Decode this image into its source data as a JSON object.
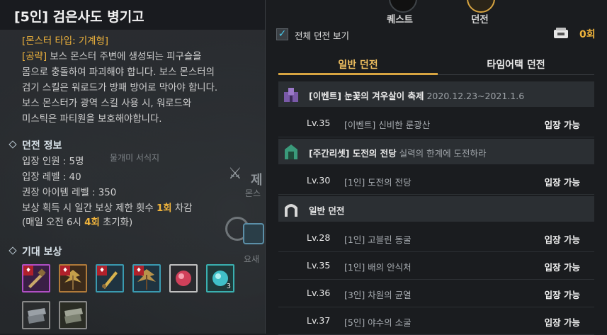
{
  "left": {
    "title": "[5인] 검은사도 병기고",
    "monster_type": "[몬스터 타입: 기계형]",
    "strategy_tag": "[공략]",
    "strategy_lines": [
      " 보스 몬스터 주변에 생성되는 피구슬을",
      "몸으로 충돌하여 파괴해야 합니다. 보스 몬스터의",
      "검기 스킬은 워로드가 방패 방어로 막아야 합니다.",
      "보스 몬스터가 광역 스킬 사용 시, 워로드와",
      "미스틱은 파티원을 보호해야합니다."
    ],
    "info_header": "던전 정보",
    "info_lines": [
      "입장 인원 : 5명",
      "입장 레벨 : 40",
      "권장 아이템 레벨 : 350"
    ],
    "reward_limit_prefix": "보상 획득 시 일간 보상 제한 횟수 ",
    "reward_limit_value": "1회",
    "reward_limit_suffix": " 차감",
    "reset_prefix": "(매일 오전 6시 ",
    "reset_value": "4회",
    "reset_suffix": " 초기화)",
    "rewards_header": "기대 보상",
    "map_labels": {
      "area": "물개미 서식지",
      "big": "제",
      "small1": "몬스",
      "small2": "요새"
    },
    "rewards": [
      {
        "icon": "greatsword-icon",
        "badge": "♦",
        "count": "",
        "border": "#b04fc4"
      },
      {
        "icon": "winged-staff-icon",
        "badge": "♦",
        "count": "",
        "border": "#b07a3a"
      },
      {
        "icon": "golden-sword-icon",
        "badge": "♦",
        "count": "",
        "border": "#3a9ab0"
      },
      {
        "icon": "winged-staff-gold-icon",
        "badge": "♦",
        "count": "",
        "border": "#3a9ab0"
      },
      {
        "icon": "red-gem-icon",
        "badge": "",
        "count": "",
        "border": "#c0c0c0"
      },
      {
        "icon": "blue-gem-icon",
        "badge": "",
        "count": "3",
        "border": "#3ab0b0"
      },
      {
        "icon": "armor-plate-icon",
        "badge": "",
        "count": "",
        "border": "#888888"
      },
      {
        "icon": "armor-plate-gold-icon",
        "badge": "",
        "count": "",
        "border": "#888888"
      }
    ]
  },
  "right": {
    "top_tabs": [
      {
        "label": "퀘스트",
        "active": false
      },
      {
        "label": "던전",
        "active": true
      }
    ],
    "checkbox_label": "전체 던전 보기",
    "checkbox_checked": "✓",
    "ticket_count": "0회",
    "sub_tabs": [
      {
        "label": "일반 던전",
        "active": true
      },
      {
        "label": "타임어택 던전",
        "active": false
      }
    ],
    "categories": [
      {
        "title": "[이벤트] 눈꽃의 겨우살이 축제",
        "subtitle": " 2020.12.23~2021.1.6",
        "icon": "event-castle-icon",
        "items": [
          {
            "level": "Lv.35",
            "name": "[이벤트] 신비한 룬광산",
            "status": "입장 가능"
          }
        ]
      },
      {
        "title": "[주간리셋] 도전의 전당",
        "subtitle": " 실력의 한계에 도전하라",
        "icon": "weekly-gate-icon",
        "items": [
          {
            "level": "Lv.30",
            "name": "[1인] 도전의 전당",
            "status": "입장 가능"
          }
        ]
      },
      {
        "title": "일반 던전",
        "subtitle": "",
        "icon": "dungeon-gate-icon",
        "items": [
          {
            "level": "Lv.28",
            "name": "[1인] 고블린 동굴",
            "status": "입장 가능"
          },
          {
            "level": "Lv.35",
            "name": "[1인] 배의 안식처",
            "status": "입장 가능"
          },
          {
            "level": "Lv.36",
            "name": "[3인] 차원의 균열",
            "status": "입장 가능"
          },
          {
            "level": "Lv.37",
            "name": "[5인] 야수의 소굴",
            "status": "입장 가능"
          }
        ]
      }
    ],
    "colors": {
      "accent": "#d7a441",
      "highlight": "#f0b43c",
      "check": "#48c7e8"
    }
  }
}
